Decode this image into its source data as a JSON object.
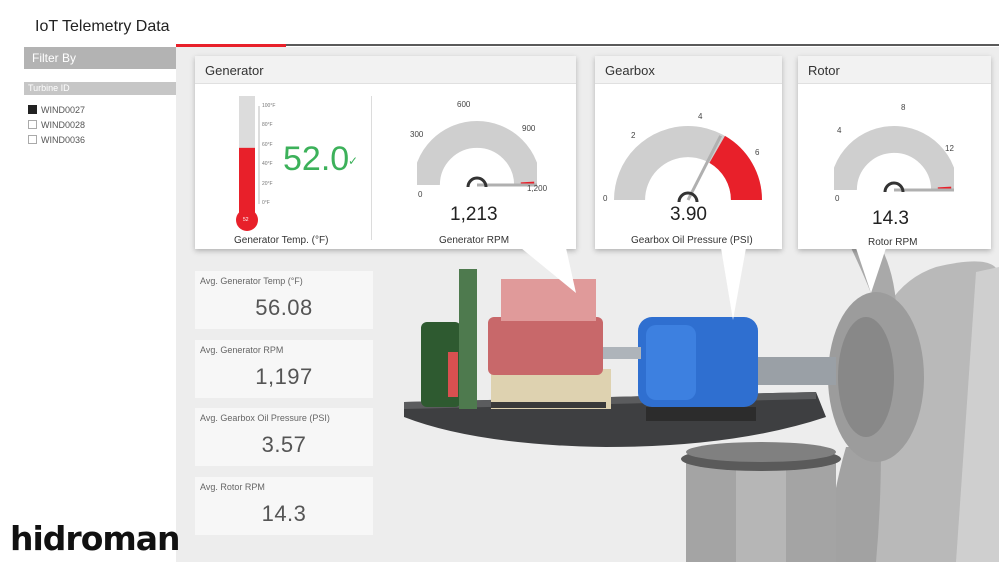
{
  "app": {
    "title": "IoT Telemetry Data"
  },
  "filter": {
    "header": "Filter By",
    "slicer_header": "Turbine ID",
    "items": [
      {
        "label": "WIND0027",
        "checked": true
      },
      {
        "label": "WIND0028",
        "checked": false
      },
      {
        "label": "WIND0036",
        "checked": false
      }
    ]
  },
  "generator": {
    "title": "Generator",
    "temp": {
      "value": "52.0",
      "value_fraction": 0.52,
      "label": "Generator Temp.  (°F)",
      "ticks": [
        "100°F",
        "80°F",
        "60°F",
        "40°F",
        "20°F",
        "0°F"
      ],
      "bulb_label": "52"
    },
    "rpm": {
      "value": "1,213",
      "value_num": 1213,
      "label": "Generator RPM",
      "ticks": [
        "0",
        "300",
        "600",
        "900",
        "1,200"
      ],
      "min": 0,
      "max": 1200
    }
  },
  "gearbox": {
    "title": "Gearbox",
    "pressure": {
      "value": "3.90",
      "value_num": 3.9,
      "label": "Gearbox Oil Pressure (PSI)",
      "ticks": [
        "0",
        "2",
        "4",
        "6"
      ],
      "min": 0,
      "max": 6,
      "red_from": 4
    }
  },
  "rotor": {
    "title": "Rotor",
    "rpm": {
      "value": "14.3",
      "value_num": 14.3,
      "label": "Rotor RPM",
      "ticks": [
        "0",
        "4",
        "8",
        "12"
      ],
      "min": 0,
      "max": 12
    }
  },
  "kpis": [
    {
      "label": "Avg. Generator Temp (°F)",
      "value": "56.08"
    },
    {
      "label": "Avg. Generator RPM",
      "value": "1,197"
    },
    {
      "label": "Avg.  Gearbox Oil Pressure (PSI)",
      "value": "3.57"
    },
    {
      "label": "Avg.  Rotor RPM",
      "value": "14.3"
    }
  ],
  "colors": {
    "accent": "#e8202a",
    "gauge_gray": "#cfcfcf",
    "temp_green": "#3cb15a",
    "gearbox_blue": "#2f6fd0"
  },
  "logo": {
    "text": "hidroman"
  }
}
